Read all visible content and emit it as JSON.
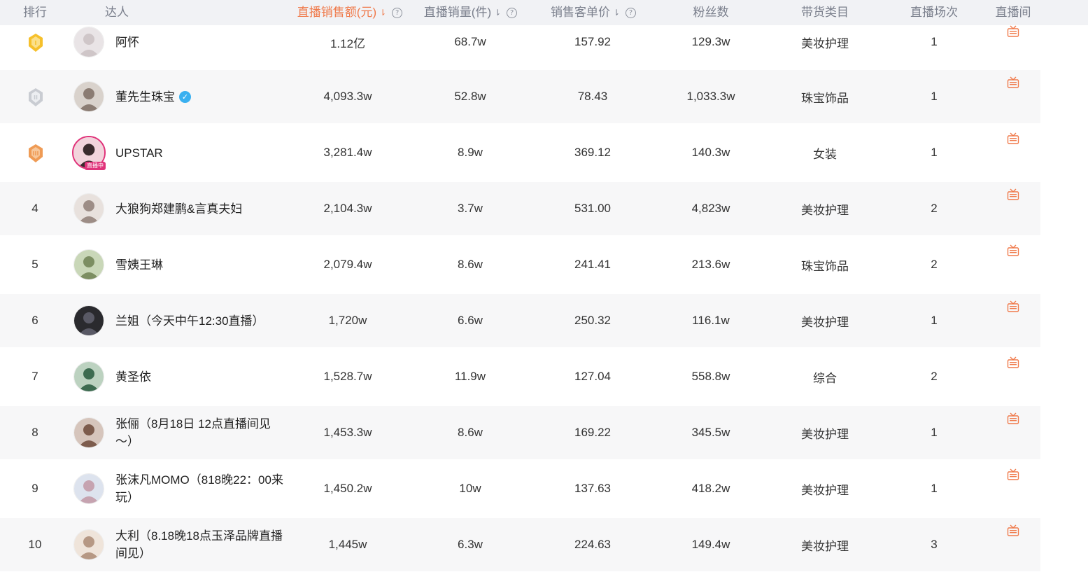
{
  "header": {
    "rank": "排行",
    "influencer": "达人",
    "sales_amount": "直播销售额(元)",
    "sales_volume": "直播销量(件)",
    "unit_price": "销售客单价",
    "fans": "粉丝数",
    "category": "带货类目",
    "sessions": "直播场次",
    "live_room": "直播间",
    "sort_arrow": "⇂",
    "help": "?"
  },
  "colors": {
    "header_bg": "#f1f2f5",
    "active_sort": "#f07a4b",
    "live_red": "#e0337a",
    "gold": "#f6c02b",
    "silver": "#c9ccd2",
    "bronze": "#ef9b55",
    "live_icon": "#f07a4b"
  },
  "rows": [
    {
      "rank": "",
      "medal": "gold",
      "name": "阿怀",
      "verified": false,
      "live": false,
      "sales": "1.12亿",
      "volume": "68.7w",
      "price": "157.92",
      "fans": "129.3w",
      "category": "美妆护理",
      "sessions": "1"
    },
    {
      "rank": "",
      "medal": "silver",
      "name": "董先生珠宝",
      "verified": true,
      "live": false,
      "sales": "4,093.3w",
      "volume": "52.8w",
      "price": "78.43",
      "fans": "1,033.3w",
      "category": "珠宝饰品",
      "sessions": "1"
    },
    {
      "rank": "",
      "medal": "bronze",
      "name": "UPSTAR",
      "verified": false,
      "live": true,
      "live_label": "直播中",
      "sales": "3,281.4w",
      "volume": "8.9w",
      "price": "369.12",
      "fans": "140.3w",
      "category": "女装",
      "sessions": "1"
    },
    {
      "rank": "4",
      "medal": "",
      "name": "大狼狗郑建鹏&言真夫妇",
      "verified": false,
      "live": false,
      "sales": "2,104.3w",
      "volume": "3.7w",
      "price": "531.00",
      "fans": "4,823w",
      "category": "美妆护理",
      "sessions": "2"
    },
    {
      "rank": "5",
      "medal": "",
      "name": "雪姨王琳",
      "verified": false,
      "live": false,
      "sales": "2,079.4w",
      "volume": "8.6w",
      "price": "241.41",
      "fans": "213.6w",
      "category": "珠宝饰品",
      "sessions": "2"
    },
    {
      "rank": "6",
      "medal": "",
      "name": "兰姐（今天中午12:30直播）",
      "verified": false,
      "live": false,
      "sales": "1,720w",
      "volume": "6.6w",
      "price": "250.32",
      "fans": "116.1w",
      "category": "美妆护理",
      "sessions": "1"
    },
    {
      "rank": "7",
      "medal": "",
      "name": "黄圣依",
      "verified": false,
      "live": false,
      "sales": "1,528.7w",
      "volume": "11.9w",
      "price": "127.04",
      "fans": "558.8w",
      "category": "综合",
      "sessions": "2"
    },
    {
      "rank": "8",
      "medal": "",
      "name": "张俪（8月18日 12点直播间见～）",
      "verified": false,
      "live": false,
      "sales": "1,453.3w",
      "volume": "8.6w",
      "price": "169.22",
      "fans": "345.5w",
      "category": "美妆护理",
      "sessions": "1"
    },
    {
      "rank": "9",
      "medal": "",
      "name": "张沫凡MOMO（818晚22：00来玩）",
      "verified": false,
      "live": false,
      "sales": "1,450.2w",
      "volume": "10w",
      "price": "137.63",
      "fans": "418.2w",
      "category": "美妆护理",
      "sessions": "1"
    },
    {
      "rank": "10",
      "medal": "",
      "name": "大利（8.18晚18点玉泽品牌直播间见）",
      "verified": false,
      "live": false,
      "sales": "1,445w",
      "volume": "6.3w",
      "price": "224.63",
      "fans": "149.4w",
      "category": "美妆护理",
      "sessions": "3"
    }
  ]
}
